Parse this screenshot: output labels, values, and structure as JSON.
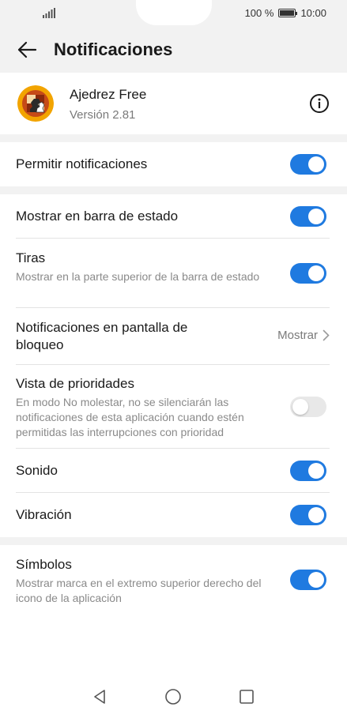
{
  "status_bar": {
    "battery_text": "100 %",
    "battery_level": 1.0,
    "time": "10:00"
  },
  "header": {
    "title": "Notificaciones"
  },
  "app": {
    "name": "Ajedrez Free",
    "version": "Versión 2.81"
  },
  "settings": {
    "allow": {
      "label": "Permitir notificaciones",
      "enabled": true
    },
    "status_bar": {
      "label": "Mostrar en barra de estado",
      "enabled": true
    },
    "banners": {
      "label": "Tiras",
      "sub": "Mostrar en la parte superior de la barra de estado",
      "enabled": true
    },
    "lock_screen": {
      "label": "Notificaciones en pantalla de bloqueo",
      "value": "Mostrar"
    },
    "priority": {
      "label": "Vista de prioridades",
      "sub": "En modo No molestar, no se silenciarán las notificaciones de esta aplicación cuando estén permitidas las interrupciones con prioridad",
      "enabled": false
    },
    "sound": {
      "label": "Sonido",
      "enabled": true
    },
    "vibration": {
      "label": "Vibración",
      "enabled": true
    },
    "badges": {
      "label": "Símbolos",
      "sub": "Mostrar marca en el extremo superior derecho del icono de la aplicación",
      "enabled": true
    }
  },
  "colors": {
    "accent": "#1f7ae0",
    "background": "#f2f2f2"
  }
}
